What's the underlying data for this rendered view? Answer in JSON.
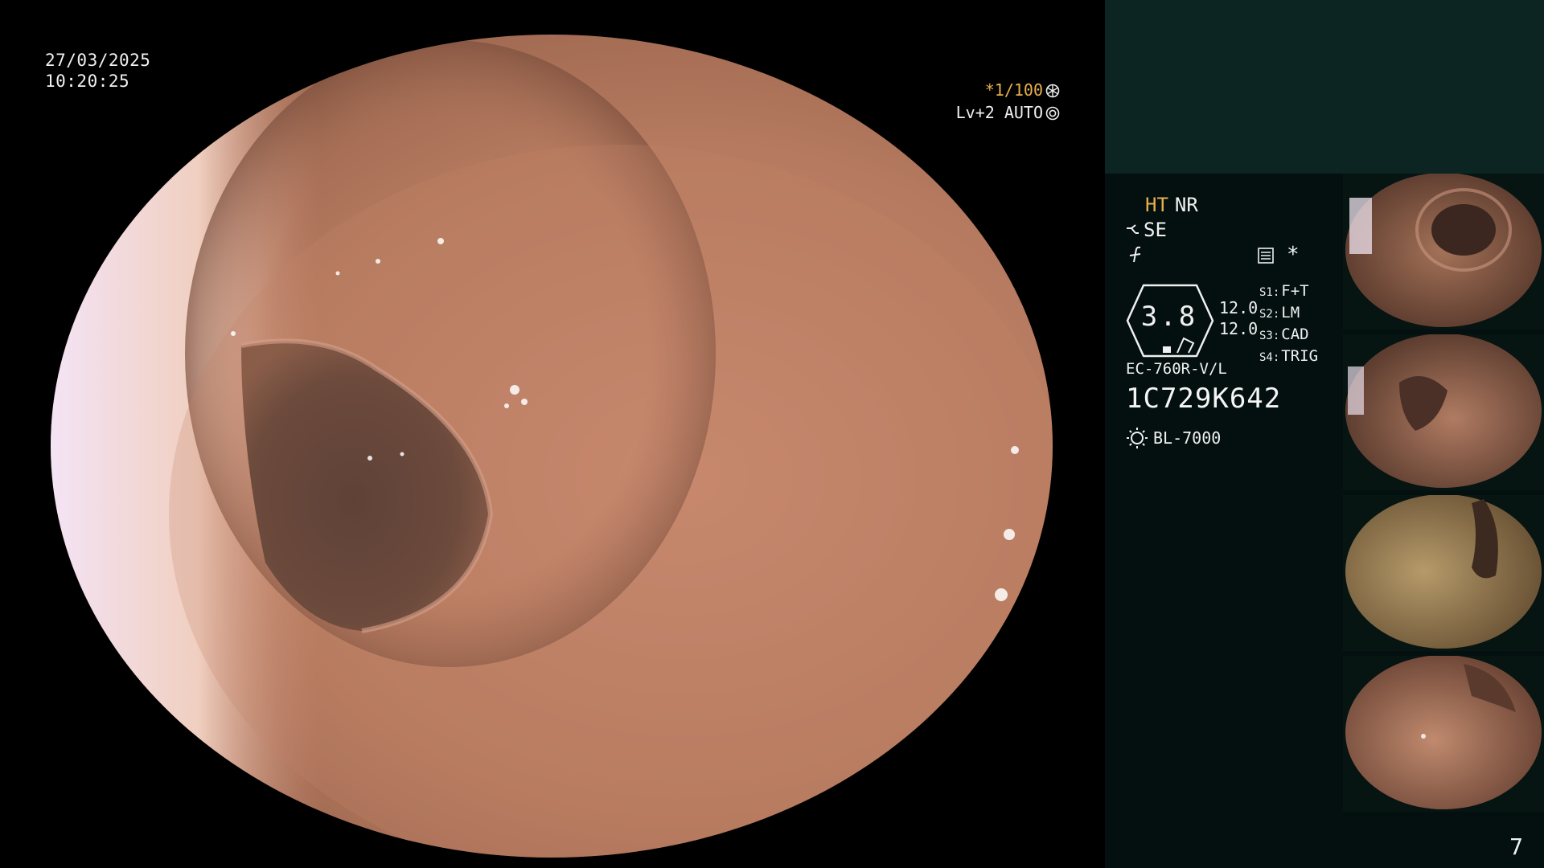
{
  "overlay": {
    "date": "27/03/2025",
    "time": "10:20:25",
    "shutter": "*1/100",
    "level": "Lv+2 AUTO"
  },
  "panel": {
    "mode_ht": "HT",
    "mode_nr": "NR",
    "mode_se": "SE",
    "asterisk": "*",
    "gauge_value": "3.8",
    "value_1": "12.0",
    "value_2": "12.0",
    "slots": [
      {
        "key": "S1:",
        "label": "F+T"
      },
      {
        "key": "S2:",
        "label": "LM"
      },
      {
        "key": "S3:",
        "label": "CAD"
      },
      {
        "key": "S4:",
        "label": "TRIG"
      }
    ],
    "scope_model": "EC-760R-V/L",
    "serial": "1C729K642",
    "light_source": "BL-7000",
    "page_number": "7"
  },
  "icons": [
    "shutter-icon",
    "auto-iris-icon",
    "se-icon",
    "f-icon",
    "menu-icon",
    "gauge-icon",
    "light-icon"
  ],
  "colors": {
    "highlight": "#e7b04a",
    "panel_bg": "#03100f",
    "panel_top_bg": "#0c2422",
    "text": "#f0f0f0"
  }
}
